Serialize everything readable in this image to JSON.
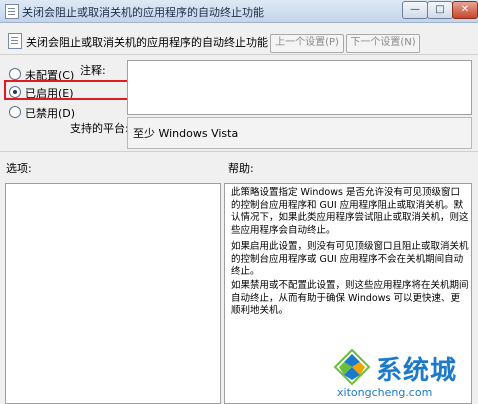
{
  "window": {
    "title": "关闭会阻止或取消关机的应用程序的自动终止功能",
    "minimize_label": "—",
    "maximize_label": "□",
    "close_label": "✕"
  },
  "header": {
    "title": "关闭会阻止或取消关机的应用程序的自动终止功能",
    "prev_label": "上一个设置(P)",
    "next_label": "下一个设置(N)"
  },
  "state": {
    "options": [
      {
        "label": "未配置(C)",
        "checked": false
      },
      {
        "label": "已启用(E)",
        "checked": true
      },
      {
        "label": "已禁用(D)",
        "checked": false
      }
    ],
    "highlight_color": "#e01b24"
  },
  "comment": {
    "label": "注释:",
    "value": ""
  },
  "platform": {
    "label": "支持的平台:",
    "value": "至少 Windows Vista"
  },
  "options_label": "选项:",
  "help": {
    "label": "帮助:",
    "paragraphs": [
      "此策略设置指定 Windows 是否允许没有可见顶级窗口的控制台应用程序和 GUI 应用程序阻止或取消关机。默认情况下，如果此类应用程序尝试阻止或取消关机，则这些应用程序会自动终止。",
      "如果启用此设置，则没有可见顶级窗口且阻止或取消关机的控制台应用程序或 GUI 应用程序不会在关机期间自动终止。",
      "如果禁用或不配置此设置，则这些应用程序将在关机期间自动终止，从而有助于确保 Windows 可以更快速、更顺利地关机。"
    ]
  },
  "watermark": {
    "brand": "系统城",
    "domain": "xitongcheng.com",
    "color": "#1d79c9"
  }
}
